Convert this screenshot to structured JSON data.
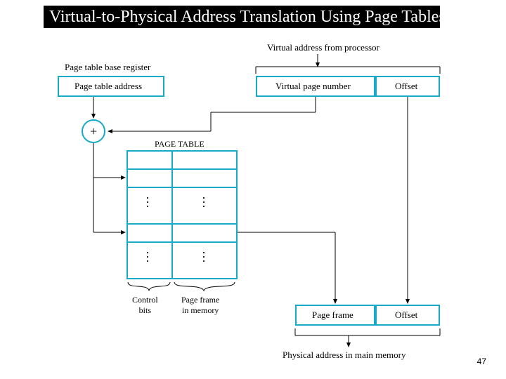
{
  "title": "Virtual-to-Physical Address Translation Using Page Tables",
  "labels": {
    "virtual_addr": "Virtual address from processor",
    "ptbr": "Page table base register",
    "pta": "Page table address",
    "vpn": "Virtual page number",
    "offset_top": "Offset",
    "plus": "+",
    "page_table_heading": "PAGE TABLE",
    "control_bits": "Control\nbits",
    "page_frame_mem": "Page frame\nin memory",
    "page_frame": "Page frame",
    "offset_bottom": "Offset",
    "phys_addr": "Physical address in main memory"
  },
  "page_number": "47",
  "colors": {
    "accent": "#18a9c9",
    "line": "#000000"
  }
}
